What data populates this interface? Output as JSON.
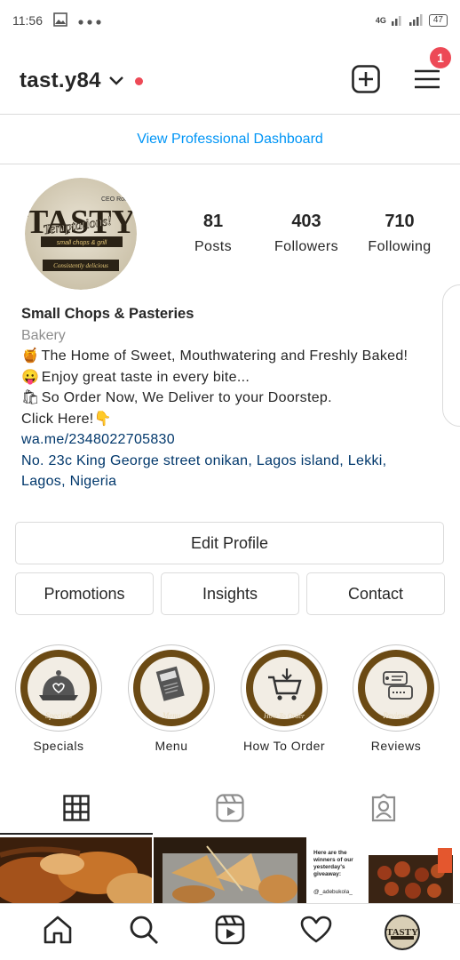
{
  "status_bar": {
    "time": "11:56",
    "network": "4G",
    "battery": "47"
  },
  "header": {
    "username": "tast.y84",
    "notification_count": "1"
  },
  "pro_dashboard": {
    "label": "View Professional Dashboard"
  },
  "profile": {
    "avatar_brand": "TASTY",
    "avatar_script": "Temptations!",
    "avatar_sub": "small chops & grill",
    "avatar_ceo": "CEO Roche",
    "avatar_tag": "Consistently delicious"
  },
  "stats": {
    "posts": {
      "value": "81",
      "label": "Posts"
    },
    "followers": {
      "value": "403",
      "label": "Followers"
    },
    "following": {
      "value": "710",
      "label": "Following"
    }
  },
  "bio": {
    "name": "Small Chops & Pasteries",
    "category": "Bakery",
    "line1_emoji": "🍯",
    "line1": "The Home of Sweet, Mouthwatering and Freshly Baked!",
    "line2_emoji": "😛",
    "line2": "Enjoy great taste in every bite...",
    "line3_emoji": "🛍",
    "line3": "So Order Now, We Deliver to your Doorstep.",
    "line4": "Click Here!👇",
    "link": "wa.me/2348022705830",
    "address_line1": "No. 23c King George street onikan, Lagos island, Lekki,",
    "address_line2": "Lagos, Nigeria"
  },
  "buttons": {
    "edit_profile": "Edit Profile",
    "promotions": "Promotions",
    "insights": "Insights",
    "contact": "Contact"
  },
  "highlights": [
    {
      "label": "Specials",
      "ring_text": "Specials"
    },
    {
      "label": "Menu",
      "ring_text": "Menu"
    },
    {
      "label": "How To Order",
      "ring_text": "How To Order"
    },
    {
      "label": "Reviews",
      "ring_text": "Reviews"
    }
  ],
  "grid_posts": [
    {
      "caption": ""
    },
    {
      "caption": ""
    },
    {
      "caption": "Here are the winners of our yesterday's giveaway:",
      "handle": "@_adebukola_"
    }
  ],
  "colors": {
    "accent_blue": "#0095f6",
    "badge_red": "#ed4956",
    "link_navy": "#00376b",
    "highlight_brown": "#6b4a14"
  }
}
